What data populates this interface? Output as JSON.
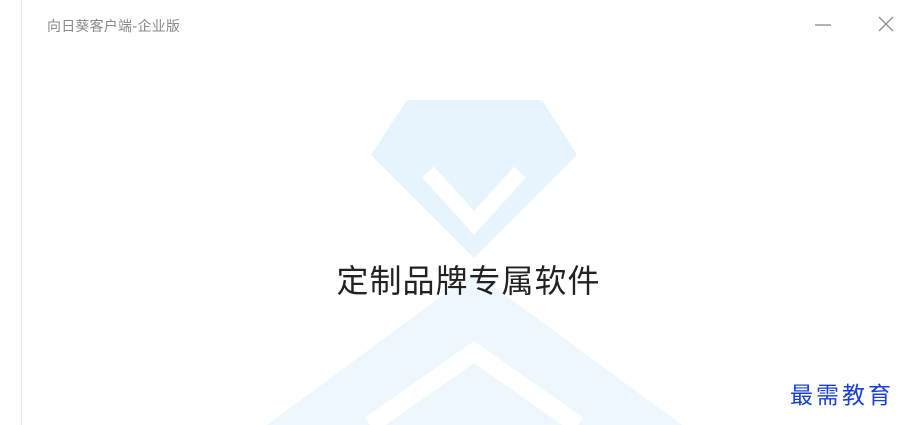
{
  "window": {
    "title": "向日葵客户端-企业版"
  },
  "splash": {
    "slogan": "定制品牌专属软件"
  },
  "watermark": {
    "text": "最需教育"
  },
  "colors": {
    "title_text": "#888888",
    "slogan_text": "#222222",
    "logo_tint": "#e6f4fd",
    "watermark_text": "#1a3fd6"
  },
  "icons": {
    "minimize": "minimize-icon",
    "close": "close-icon",
    "logo": "diamond-chevron-logo"
  }
}
